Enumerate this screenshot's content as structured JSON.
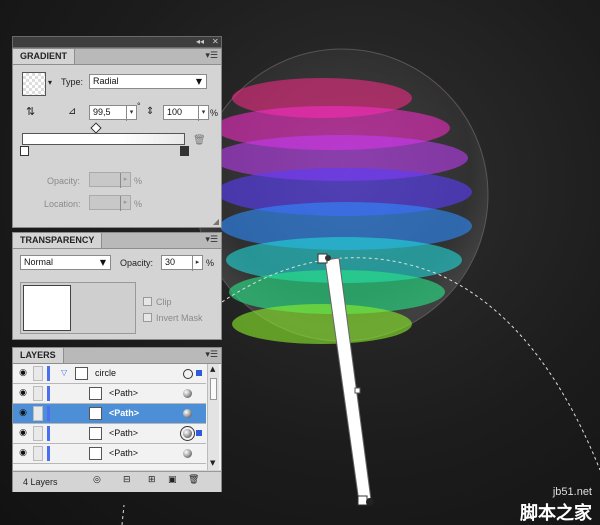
{
  "panel_strip": {
    "collapse_icon": "double-chevron-left-icon",
    "close_icon": "close-icon"
  },
  "gradient": {
    "tab_label": "GRADIENT",
    "type_label": "Type:",
    "type_value": "Radial",
    "angle_value": "99,5",
    "degree_sign": "°",
    "aspect_value": "100",
    "aspect_unit": "%",
    "opacity_label": "Opacity:",
    "opacity_unit": "%",
    "location_label": "Location:",
    "location_unit": "%"
  },
  "transparency": {
    "tab_label": "TRANSPARENCY",
    "blend_mode": "Normal",
    "opacity_label": "Opacity:",
    "opacity_value": "30",
    "opacity_unit": "%",
    "clip_label": "Clip",
    "invert_mask_label": "Invert Mask"
  },
  "layers": {
    "tab_label": "LAYERS",
    "rows": [
      {
        "name": "circle",
        "selected": false,
        "type": "layer"
      },
      {
        "name": "<Path>",
        "selected": false,
        "type": "path"
      },
      {
        "name": "<Path>",
        "selected": true,
        "type": "path"
      },
      {
        "name": "<Path>",
        "selected": false,
        "type": "path"
      },
      {
        "name": "<Path>",
        "selected": false,
        "type": "path"
      }
    ],
    "footer_count": "4 Layers"
  },
  "watermark": {
    "site": "jb51.net",
    "brand": "脚本之家"
  },
  "colors": {
    "panel_bg": "#d4d4d4",
    "selection": "#4d8fd6",
    "layer_color": "#4a6ff0",
    "canvas_bg": "#1c1c1c"
  }
}
